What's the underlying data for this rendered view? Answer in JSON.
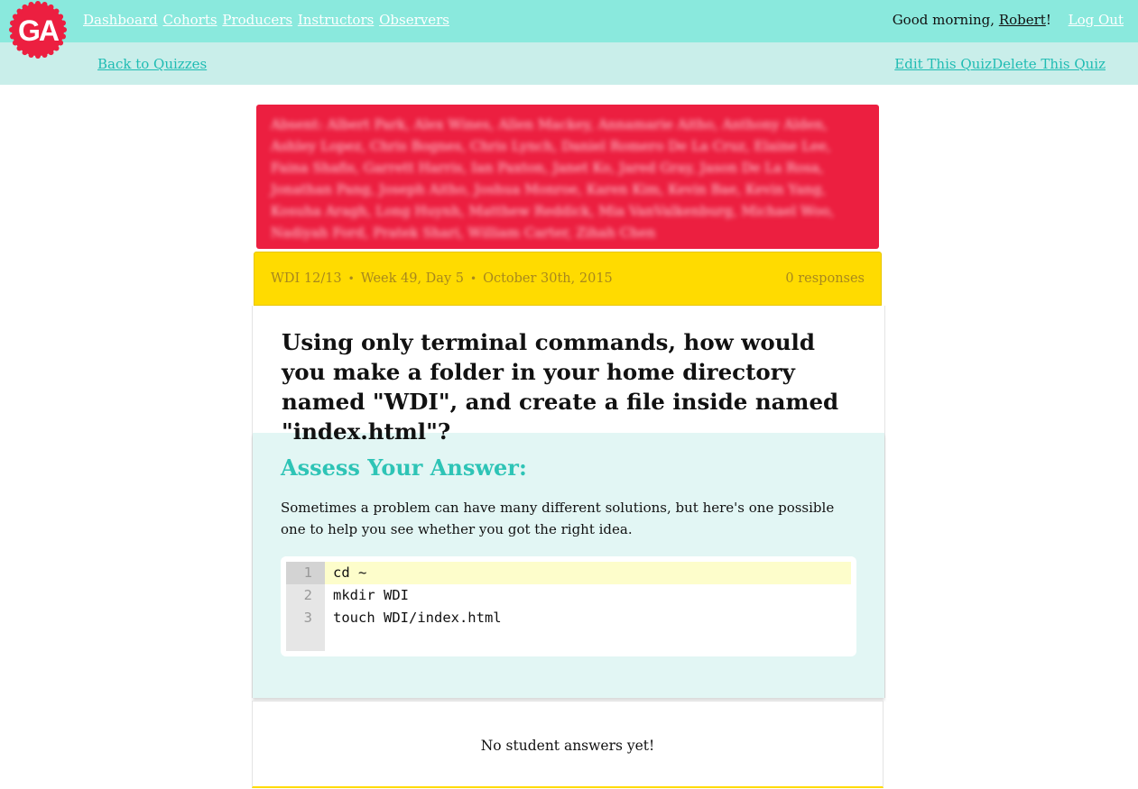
{
  "nav": {
    "links": [
      "Dashboard",
      "Cohorts",
      "Producers",
      "Instructors",
      "Observers"
    ],
    "greeting_prefix": "Good morning, ",
    "user": "Robert",
    "greeting_suffix": "!",
    "logout": "Log Out",
    "logo_text": "GA"
  },
  "subnav": {
    "back": "Back to Quizzes",
    "edit": "Edit This Quiz",
    "delete": "Delete This Quiz"
  },
  "absent": {
    "text": "Absent: Albert Park, Alex Wines, Allen Mackey, Annamarie Aitho, Anthony Alden, Ashley Lopez, Chris Bognes, Chris Lynch, Daniel Romero De La Cruz, Elaine Lee, Faina Shafis, Garrett Harris, Ian Paxton, Janet Ko, Jared Gray, Jason De La Rosa, Jonathan Pang, Joseph Aitho, Joshua Monroe, Karen Kim, Kevin Bae, Kevin Yang, Kosuha Aragh, Long Huynh, Matthew Reddick, Mia VanValkenburg, Michael Woo, Nadiyah Ford, Pratek Shari, William Carter, Zihah Chen"
  },
  "meta": {
    "cohort": "WDI 12/13",
    "week": "Week 49, Day 5",
    "date": "October 30th, 2015",
    "separator": "•",
    "responses": "0 responses"
  },
  "question": "Using only terminal commands, how would you make a folder in your home directory named \"WDI\", and create a file inside named \"index.html\"?",
  "assess": {
    "heading": "Assess Your Answer:",
    "body": "Sometimes a problem can have many different solutions, but here's one possible one to help you see whether you got the right idea.",
    "line_numbers": [
      "1",
      "2",
      "3"
    ],
    "code_lines": [
      "cd ~",
      "mkdir WDI",
      "touch WDI/index.html"
    ]
  },
  "answers": {
    "empty_text": "No student answers yet!"
  },
  "colors": {
    "nav_bg": "#8ae9dd",
    "subnav_bg": "#c9eeea",
    "absent_bg": "#ec1f40",
    "meta_bg": "#ffdb00",
    "accent": "#2ec4b6",
    "logo": "#ec1f40"
  }
}
